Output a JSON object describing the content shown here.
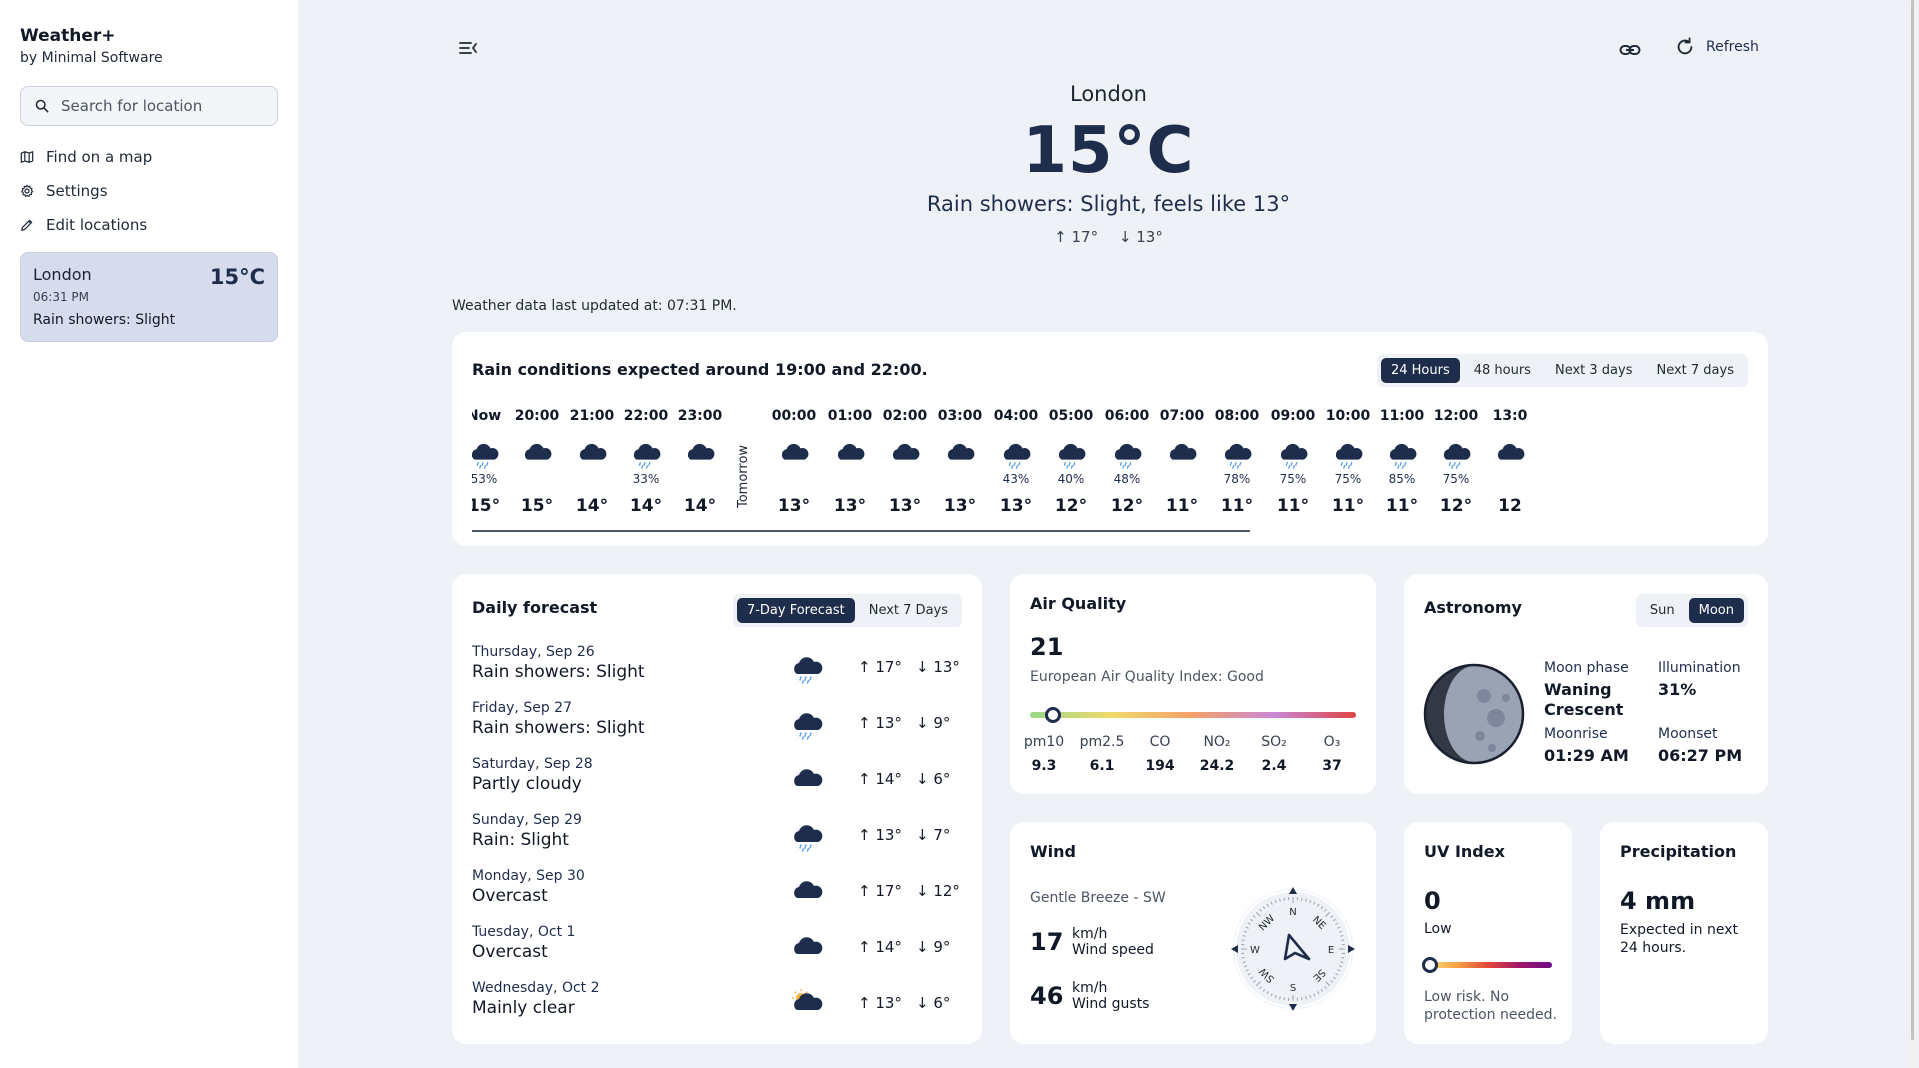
{
  "app": {
    "title": "Weather+",
    "subtitle": "by Minimal Software"
  },
  "search": {
    "placeholder": "Search for location"
  },
  "nav": [
    {
      "label": "Find on a map",
      "icon": "map-icon"
    },
    {
      "label": "Settings",
      "icon": "gear-icon"
    },
    {
      "label": "Edit locations",
      "icon": "pencil-icon"
    }
  ],
  "saved_location": {
    "name": "London",
    "time": "06:31 PM",
    "condition": "Rain showers: Slight",
    "temp": "15°C"
  },
  "toolbar": {
    "refresh_label": "Refresh"
  },
  "hero": {
    "location": "London",
    "temp": "15°C",
    "condition": "Rain showers: Slight, feels like 13°",
    "high": "17°",
    "low": "13°"
  },
  "updated": "Weather data last updated at: 07:31 PM.",
  "hourly": {
    "title": "Rain conditions expected around 19:00 and 22:00.",
    "tabs": [
      "24 Hours",
      "48 hours",
      "Next 3 days",
      "Next 7 days"
    ],
    "active_tab": 0,
    "tomorrow_label": "Tomorrow",
    "hours": [
      {
        "time": "Now",
        "icon": "rain-cloud-icon",
        "pct": "53%",
        "temp": "15°"
      },
      {
        "time": "20:00",
        "icon": "cloud-icon",
        "pct": "",
        "temp": "15°"
      },
      {
        "time": "21:00",
        "icon": "cloud-icon",
        "pct": "",
        "temp": "14°"
      },
      {
        "time": "22:00",
        "icon": "rain-cloud-icon",
        "pct": "33%",
        "temp": "14°"
      },
      {
        "time": "23:00",
        "icon": "cloud-icon",
        "pct": "",
        "temp": "14°"
      },
      {
        "time": "00:00",
        "icon": "cloud-icon",
        "pct": "",
        "temp": "13°"
      },
      {
        "time": "01:00",
        "icon": "cloud-icon",
        "pct": "",
        "temp": "13°"
      },
      {
        "time": "02:00",
        "icon": "cloud-icon",
        "pct": "",
        "temp": "13°"
      },
      {
        "time": "03:00",
        "icon": "cloud-icon",
        "pct": "",
        "temp": "13°"
      },
      {
        "time": "04:00",
        "icon": "rain-cloud-icon",
        "pct": "43%",
        "temp": "13°"
      },
      {
        "time": "05:00",
        "icon": "rain-cloud-icon",
        "pct": "40%",
        "temp": "12°"
      },
      {
        "time": "06:00",
        "icon": "rain-cloud-icon",
        "pct": "48%",
        "temp": "12°"
      },
      {
        "time": "07:00",
        "icon": "cloud-icon",
        "pct": "",
        "temp": "11°"
      },
      {
        "time": "08:00",
        "icon": "rain-cloud-icon",
        "pct": "78%",
        "temp": "11°"
      },
      {
        "time": "09:00",
        "icon": "rain-cloud-icon",
        "pct": "75%",
        "temp": "11°"
      },
      {
        "time": "10:00",
        "icon": "rain-cloud-icon",
        "pct": "75%",
        "temp": "11°"
      },
      {
        "time": "11:00",
        "icon": "rain-cloud-icon",
        "pct": "85%",
        "temp": "11°"
      },
      {
        "time": "12:00",
        "icon": "rain-cloud-icon",
        "pct": "75%",
        "temp": "12°"
      },
      {
        "time": "13:0",
        "icon": "cloud-icon",
        "pct": "",
        "temp": "12"
      }
    ]
  },
  "daily": {
    "title": "Daily forecast",
    "tabs": [
      "7-Day Forecast",
      "Next 7 Days"
    ],
    "active_tab": 0,
    "days": [
      {
        "date": "Thursday, Sep 26",
        "condition": "Rain showers: Slight",
        "icon": "rain-cloud-icon",
        "high": "17°",
        "low": "13°"
      },
      {
        "date": "Friday, Sep 27",
        "condition": "Rain showers: Slight",
        "icon": "rain-cloud-icon",
        "high": "13°",
        "low": "9°"
      },
      {
        "date": "Saturday, Sep 28",
        "condition": "Partly cloudy",
        "icon": "cloud-icon",
        "high": "14°",
        "low": "6°"
      },
      {
        "date": "Sunday, Sep 29",
        "condition": "Rain: Slight",
        "icon": "rain-cloud-icon",
        "high": "13°",
        "low": "7°"
      },
      {
        "date": "Monday, Sep 30",
        "condition": "Overcast",
        "icon": "cloud-icon",
        "high": "17°",
        "low": "12°"
      },
      {
        "date": "Tuesday, Oct 1",
        "condition": "Overcast",
        "icon": "cloud-icon",
        "high": "14°",
        "low": "9°"
      },
      {
        "date": "Wednesday, Oct 2",
        "condition": "Mainly clear",
        "icon": "sun-cloud-icon",
        "high": "13°",
        "low": "6°"
      }
    ]
  },
  "air_quality": {
    "title": "Air Quality",
    "value": "21",
    "label": "European Air Quality Index: Good",
    "level_fraction": 0.07,
    "pollutants": [
      {
        "name": "pm10",
        "value": "9.3"
      },
      {
        "name": "pm2.5",
        "value": "6.1"
      },
      {
        "name": "CO",
        "value": "194"
      },
      {
        "name": "NO₂",
        "value": "24.2"
      },
      {
        "name": "SO₂",
        "value": "2.4"
      },
      {
        "name": "O₃",
        "value": "37"
      }
    ]
  },
  "astronomy": {
    "title": "Astronomy",
    "tabs": [
      "Sun",
      "Moon"
    ],
    "active_tab": 1,
    "phase_label": "Moon phase",
    "phase": "Waning Crescent",
    "illum_label": "Illumination",
    "illum": "31%",
    "rise_label": "Moonrise",
    "rise": "01:29 AM",
    "set_label": "Moonset",
    "set": "06:27 PM"
  },
  "wind": {
    "title": "Wind",
    "desc": "Gentle Breeze - SW",
    "speed": "17",
    "speed_unit": "km/h",
    "speed_label": "Wind speed",
    "gusts": "46",
    "gusts_unit": "km/h",
    "gusts_label": "Wind gusts",
    "compass": [
      "N",
      "NE",
      "E",
      "SE",
      "S",
      "SW",
      "W",
      "NW"
    ]
  },
  "uv": {
    "title": "UV Index",
    "value": "0",
    "label": "Low",
    "note": "Low risk. No protection needed.",
    "level_fraction": 0.0
  },
  "precipitation": {
    "title": "Precipitation",
    "value": "4 mm",
    "note": "Expected in next 24 hours."
  },
  "colors": {
    "accent": "#1f2d4d",
    "background": "#eef1f6",
    "card": "#ffffff",
    "selected_location": "#d6dcec"
  }
}
